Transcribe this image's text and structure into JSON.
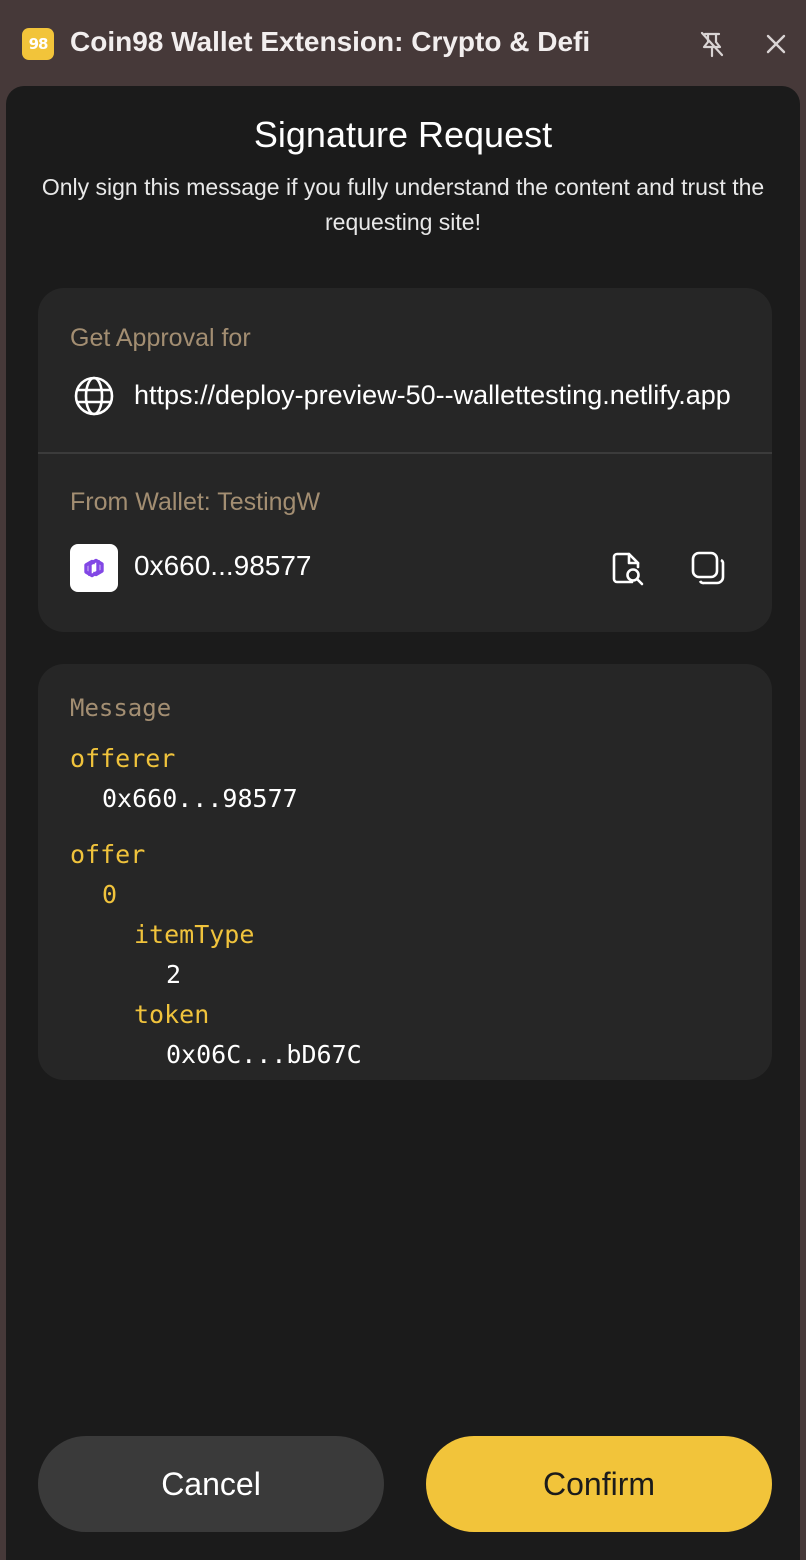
{
  "window": {
    "title": "Coin98 Wallet Extension: Crypto & Defi",
    "app_icon_text": "98",
    "icons": {
      "pin": "unpin-icon",
      "close": "close-icon"
    }
  },
  "header": {
    "title": "Signature Request",
    "subtitle": "Only sign this message if you fully understand the content and trust the requesting site!"
  },
  "approval": {
    "label": "Get Approval for",
    "site_url": "https://deploy-preview-50--wallettesting.netlify.app",
    "site_icon": "globe-icon"
  },
  "wallet": {
    "label": "From Wallet: TestingW",
    "address": "0x660...98577",
    "chain_icon": "polygon-logo",
    "actions": [
      "explorer-search-icon",
      "copy-icon"
    ]
  },
  "message": {
    "title": "Message",
    "fields": [
      {
        "key": "offerer",
        "value": "0x660...98577"
      },
      {
        "key": "offer",
        "index": "0",
        "item_type_key": "itemType",
        "item_type_value": "2",
        "token_key": "token",
        "token_value": "0x06C...bD67C"
      }
    ]
  },
  "buttons": {
    "cancel": "Cancel",
    "confirm": "Confirm"
  },
  "colors": {
    "accent": "#f2c43a",
    "key": "#f0c33c",
    "muted_label": "#a38e72",
    "panel": "#1b1b1b",
    "card": "#262626",
    "titlebar": "#463939"
  }
}
